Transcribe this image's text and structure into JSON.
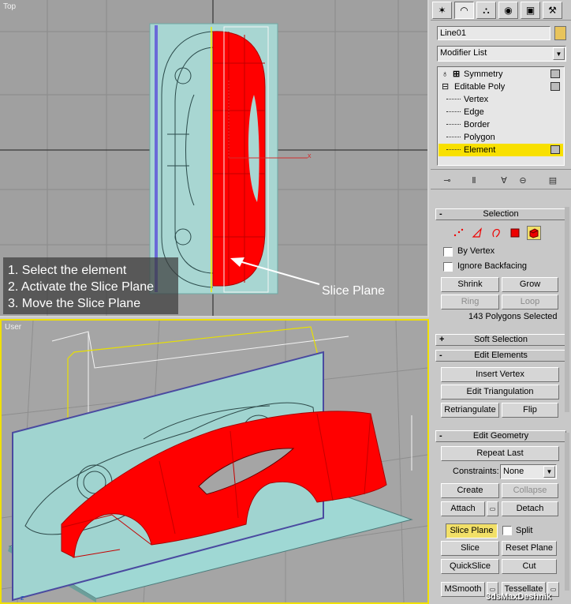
{
  "viewports": {
    "top_label": "Top",
    "user_label": "User",
    "axis_label_z": "z",
    "instructions": [
      "1. Select the element",
      "2. Activate the Slice Plane",
      "3. Move the Slice Plane"
    ],
    "slice_plane_callout": "Slice Plane"
  },
  "panel": {
    "tabs": [
      "create-icon",
      "modify-icon",
      "hierarchy-icon",
      "motion-icon",
      "display-icon",
      "utilities-icon"
    ],
    "object_name": "Line01",
    "object_color": "#e8c45c",
    "modifier_list": "Modifier List",
    "stack": [
      {
        "label": "Symmetry",
        "level": 0
      },
      {
        "label": "Editable Poly",
        "level": 0
      },
      {
        "label": "Vertex",
        "level": 1
      },
      {
        "label": "Edge",
        "level": 1
      },
      {
        "label": "Border",
        "level": 1
      },
      {
        "label": "Polygon",
        "level": 1
      },
      {
        "label": "Element",
        "level": 1,
        "selected": true
      }
    ],
    "selection": {
      "title": "Selection",
      "by_vertex": "By Vertex",
      "ignore_backfacing": "Ignore Backfacing",
      "shrink": "Shrink",
      "grow": "Grow",
      "ring": "Ring",
      "loop": "Loop",
      "status": "143 Polygons Selected"
    },
    "soft_selection": {
      "title": "Soft Selection"
    },
    "edit_elements": {
      "title": "Edit Elements",
      "insert_vertex": "Insert Vertex",
      "edit_triangulation": "Edit Triangulation",
      "retriangulate": "Retriangulate",
      "flip": "Flip"
    },
    "edit_geometry": {
      "title": "Edit Geometry",
      "repeat_last": "Repeat Last",
      "constraints_label": "Constraints:",
      "constraints_value": "None",
      "create": "Create",
      "collapse": "Collapse",
      "attach": "Attach",
      "detach": "Detach",
      "slice_plane": "Slice Plane",
      "split": "Split",
      "slice": "Slice",
      "reset_plane": "Reset Plane",
      "quickslice": "QuickSlice",
      "cut": "Cut",
      "msmooth": "MSmooth",
      "tessellate": "Tessellate"
    }
  },
  "watermark": "3dsMaxDeshnik",
  "colors": {
    "accent_yellow": "#f8e000",
    "car_red": "#ff0000",
    "plane_cyan": "#9fd8d4"
  }
}
